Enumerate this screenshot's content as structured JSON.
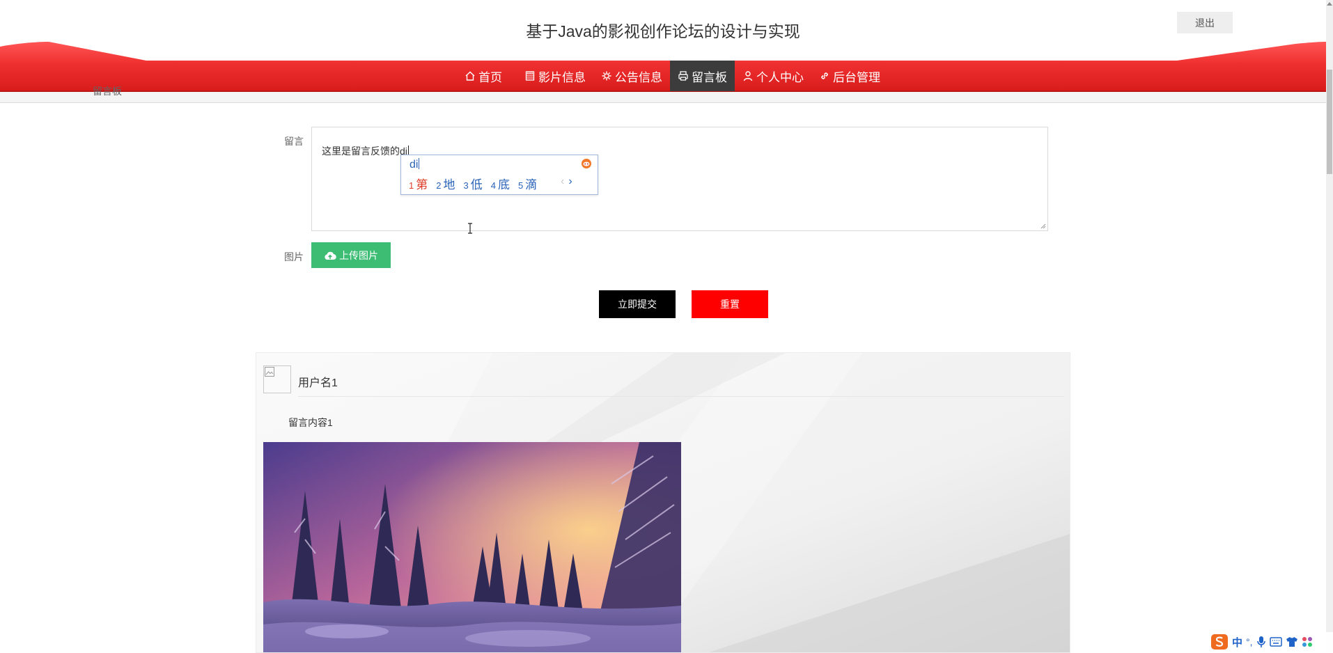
{
  "header": {
    "site_title": "基于Java的影视创作论坛的设计与实现",
    "logout_label": "退出"
  },
  "nav": {
    "items": [
      {
        "label": "首页",
        "icon": "home-icon"
      },
      {
        "label": "影片信息",
        "icon": "film-icon"
      },
      {
        "label": "公告信息",
        "icon": "gear-icon"
      },
      {
        "label": "留言板",
        "icon": "printer-icon",
        "active": true
      },
      {
        "label": "个人中心",
        "icon": "user-icon"
      },
      {
        "label": "后台管理",
        "icon": "link-icon"
      }
    ]
  },
  "breadcrumb": {
    "text": "留言板"
  },
  "form": {
    "message_label": "留言",
    "message_value": "这里是留言反馈的di",
    "image_label": "图片",
    "upload_label": "上传图片",
    "submit_label": "立即提交",
    "reset_label": "重置"
  },
  "ime_popup": {
    "input": "di",
    "candidates": [
      {
        "num": "1",
        "text": "第"
      },
      {
        "num": "2",
        "text": "地"
      },
      {
        "num": "3",
        "text": "低"
      },
      {
        "num": "4",
        "text": "底"
      },
      {
        "num": "5",
        "text": "滴"
      }
    ],
    "prev_symbol": "‹",
    "next_symbol": "›"
  },
  "message_card": {
    "username": "用户名1",
    "content": "留言内容1"
  },
  "ime_bar": {
    "mode": "中",
    "punct": "°,"
  },
  "colors": {
    "nav_red": "#ef2a2a",
    "nav_active": "#3c3c3c",
    "upload_green": "#3dbd74",
    "submit_black": "#000000",
    "reset_red": "#ff0000"
  }
}
